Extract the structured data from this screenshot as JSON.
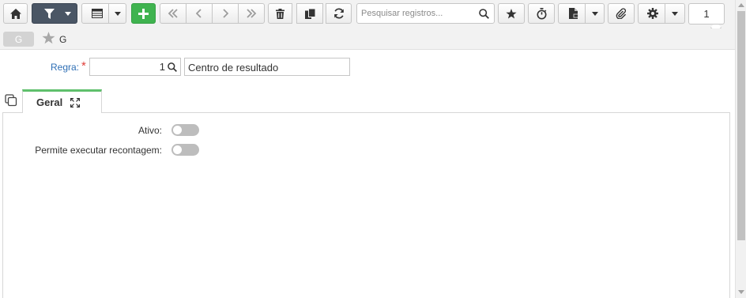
{
  "toolbar": {
    "buttons": [
      {
        "name": "home-button",
        "icon": "home-icon"
      },
      {
        "name": "filter-button",
        "icon": "filter-icon"
      },
      {
        "name": "view-mode-button",
        "icon": "table-icon"
      },
      {
        "name": "add-button",
        "icon": "plus-icon"
      },
      {
        "name": "first-record-button",
        "icon": "double-chevron-left-icon"
      },
      {
        "name": "previous-record-button",
        "icon": "chevron-left-icon"
      },
      {
        "name": "next-record-button",
        "icon": "chevron-right-icon"
      },
      {
        "name": "last-record-button",
        "icon": "double-chevron-right-icon"
      },
      {
        "name": "delete-button",
        "icon": "trash-icon"
      },
      {
        "name": "duplicate-button",
        "icon": "copy-icon"
      },
      {
        "name": "refresh-button",
        "icon": "refresh-icon"
      },
      {
        "name": "favorite-button",
        "icon": "star-icon"
      },
      {
        "name": "timer-button",
        "icon": "stopwatch-icon"
      },
      {
        "name": "report-button",
        "icon": "document-icon"
      },
      {
        "name": "attachment-button",
        "icon": "paperclip-icon"
      },
      {
        "name": "settings-button",
        "icon": "gear-icon"
      }
    ],
    "search_placeholder": "Pesquisar registros...",
    "record_counter": "1"
  },
  "breadcrumb": {
    "badge": "G",
    "title": "G"
  },
  "form": {
    "regra_label": "Regra:",
    "required_mark": "*",
    "regra_code": "1",
    "regra_description": "Centro de resultado"
  },
  "tabs": [
    {
      "label": "Geral",
      "active": true
    }
  ],
  "fields": {
    "ativo_label": "Ativo:",
    "ativo_value": false,
    "recontagem_label": "Permite executar recontagem:",
    "recontagem_value": false
  },
  "colors": {
    "accent_green": "#5fc06c",
    "add_green": "#3fb34f",
    "filter_dark": "#4a5665",
    "link_blue": "#2f6fb5",
    "required_red": "#e0403b"
  }
}
